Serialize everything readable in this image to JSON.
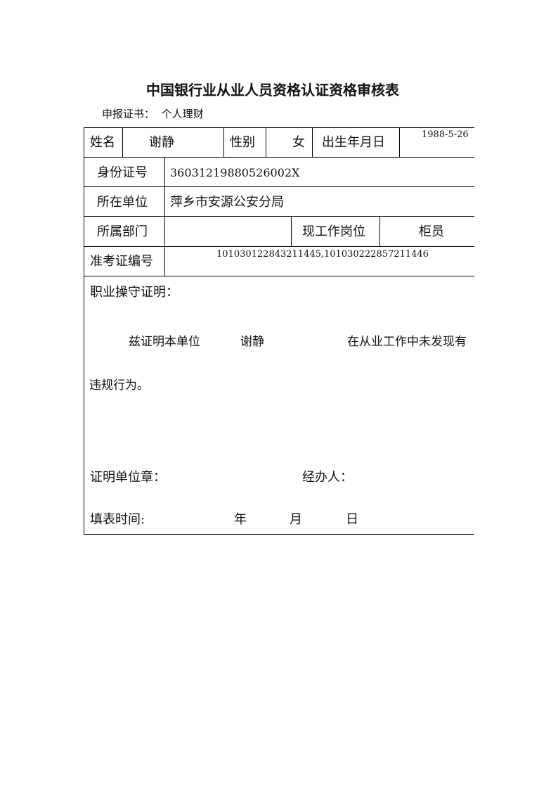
{
  "title": "中国银行业从业人员资格认证资格审核表",
  "certificate": {
    "label": "申报证书：",
    "value": "个人理财"
  },
  "table": {
    "name_label": "姓名",
    "name": "谢静",
    "gender_label": "性别",
    "gender": "女",
    "birth_label": "出生年月日",
    "birth": "1988-5-26",
    "id_label": "身份证号",
    "id": "36031219880526002X",
    "unit_label": "所在单位",
    "unit": "萍乡市安源公安分局",
    "dept_label": "所属部门",
    "dept": "",
    "post_label": "现工作岗位",
    "post": "柜员",
    "exam_label": "准考证编号",
    "exam": "101030122843211445,101030222857211446"
  },
  "proof": {
    "label": "职业操守证明：",
    "line1_a": "兹证明本单位",
    "line1_name": "谢静",
    "line1_b": "在从业工作中未发现有",
    "line2": "违规行为。",
    "seal_label": "证明单位章：",
    "handler_label": "经办人：",
    "date_label": "填表时间:",
    "year": "年",
    "month": "月",
    "day": "日"
  }
}
